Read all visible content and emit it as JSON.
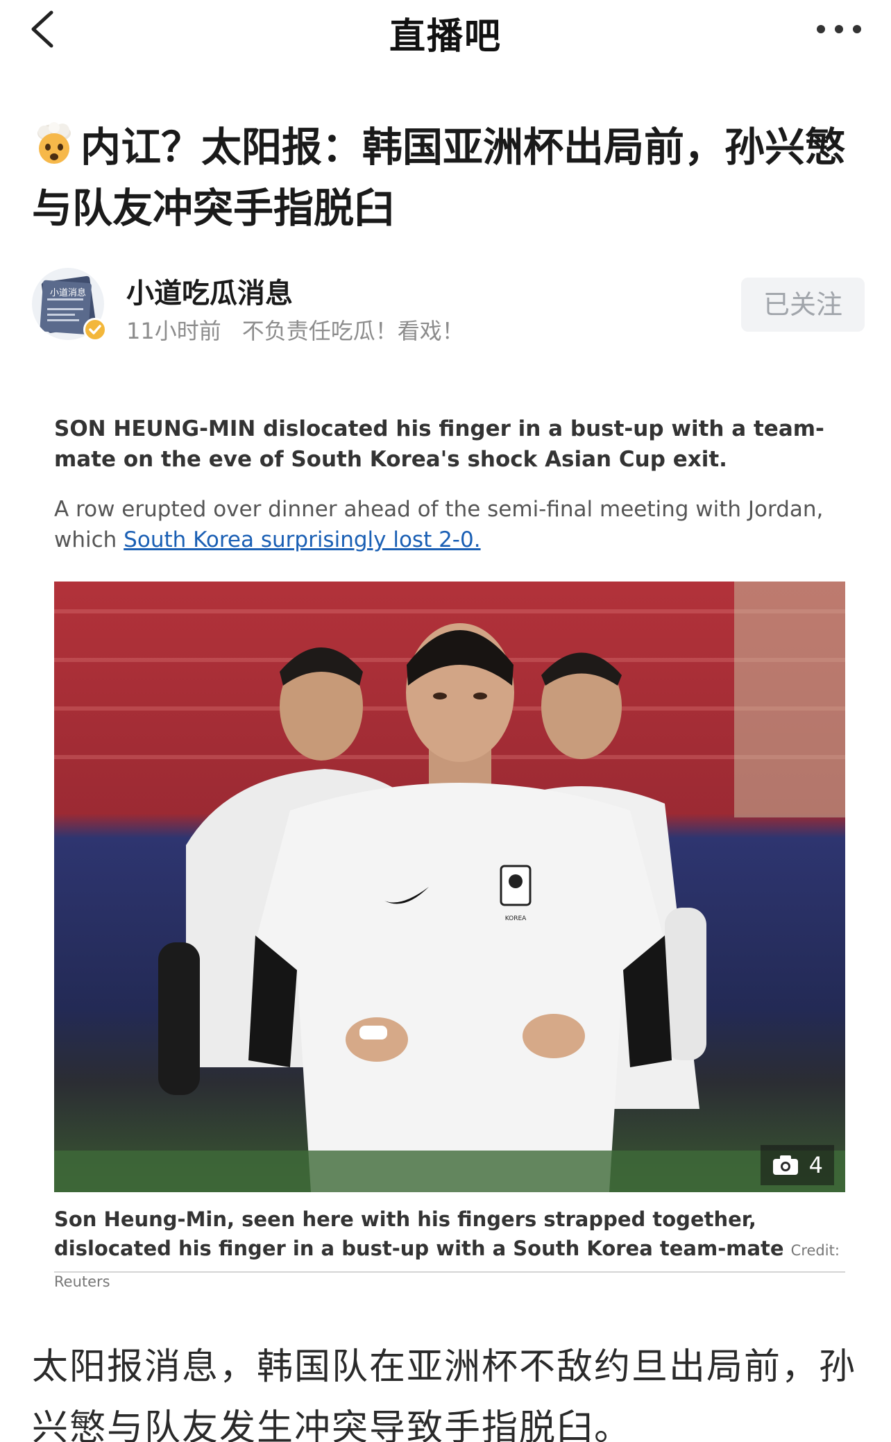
{
  "nav": {
    "brand": "直播吧"
  },
  "article": {
    "title": "内讧？太阳报：韩国亚洲杯出局前，孙兴慜与队友冲突手指脱臼",
    "author": {
      "name": "小道吃瓜消息",
      "avatar_text": "小道消息",
      "time": "11小时前",
      "bio": "不负责任吃瓜！看戏！",
      "follow_label": "已关注"
    },
    "embed": {
      "lede": "SON HEUNG-MIN dislocated his finger in a bust-up with a team-mate on the eve of South Korea's shock Asian Cup exit.",
      "para_prefix": "A row erupted over dinner ahead of the semi-final meeting with Jordan, which",
      "para_link": "South Korea surprisingly lost 2-0.",
      "photo_count": "4",
      "jersey_text": "KOREA",
      "caption": "Son Heung-Min, seen here with his fingers strapped together, dislocated his finger in a bust-up with a South Korea team-mate",
      "credit": "Credit: Reuters"
    },
    "body": "太阳报消息，韩国队在亚洲杯不敌约旦出局前，孙兴慜与队友发生冲突导致手指脱臼。"
  }
}
